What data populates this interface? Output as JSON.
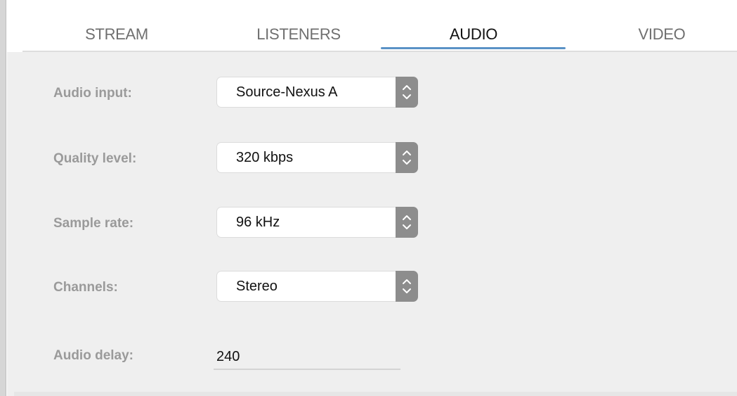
{
  "tabs": [
    {
      "label": "STREAM",
      "active": false
    },
    {
      "label": "LISTENERS",
      "active": false
    },
    {
      "label": "AUDIO",
      "active": true
    },
    {
      "label": "VIDEO",
      "active": false
    }
  ],
  "audio": {
    "audio_input": {
      "label": "Audio input:",
      "value": "Source-Nexus A"
    },
    "quality_level": {
      "label": "Quality level:",
      "value": "320 kbps"
    },
    "sample_rate": {
      "label": "Sample rate:",
      "value": "96 kHz"
    },
    "channels": {
      "label": "Channels:",
      "value": "Stereo"
    },
    "audio_delay": {
      "label": "Audio delay:",
      "value": "240"
    }
  },
  "colors": {
    "active_tab_underline": "#5a92c6",
    "content_background": "#efefef",
    "label_text": "#9a9a9a",
    "stepper_background": "#8d8d8d"
  },
  "icons": {
    "select_stepper": "chevron-up-down-icon"
  }
}
